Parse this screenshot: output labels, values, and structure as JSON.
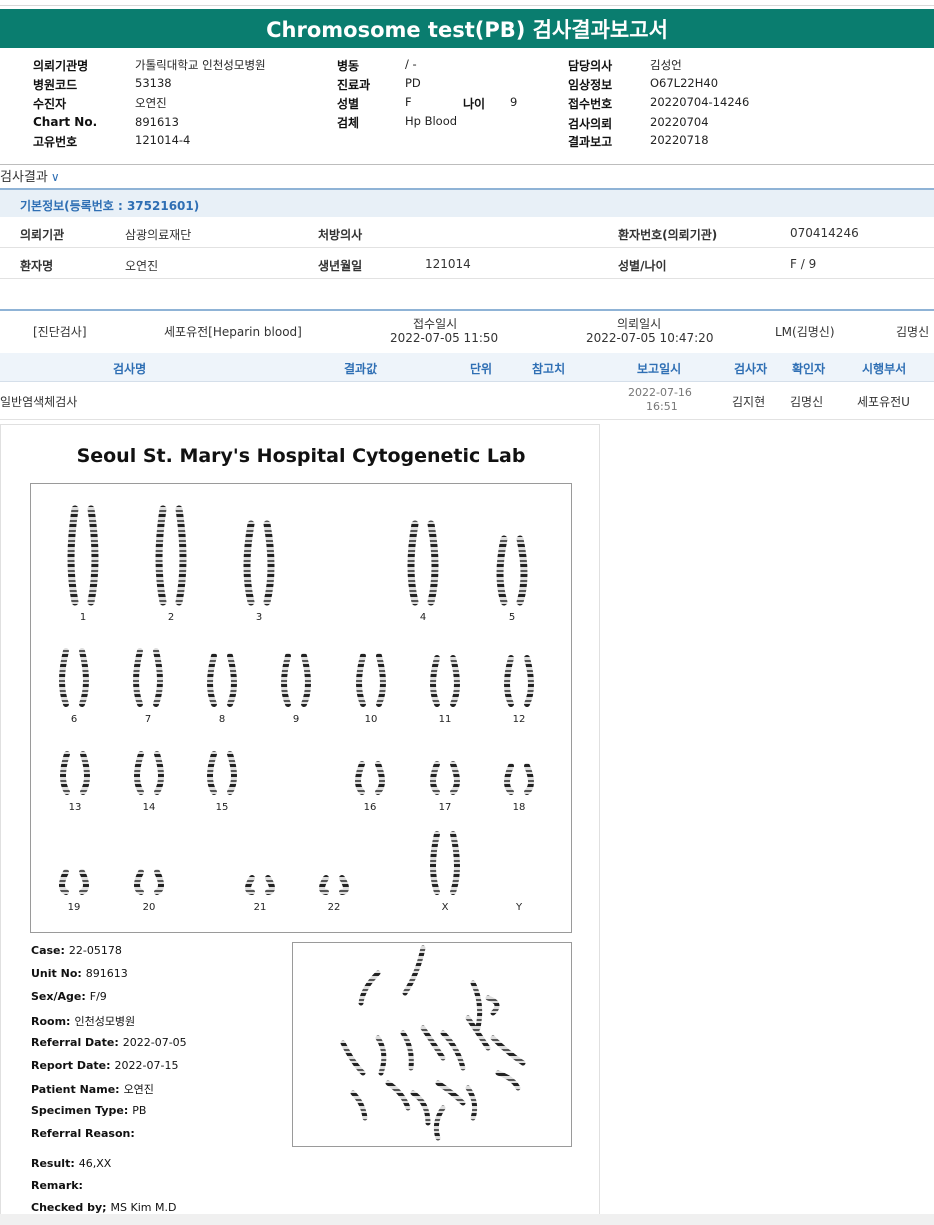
{
  "report_title": "Chromosome test(PB) 검사결과보고서",
  "header": {
    "col1": [
      {
        "label": "의뢰기관명",
        "value": "가톨릭대학교 인천성모병원"
      },
      {
        "label": "병원코드",
        "value": "53138"
      },
      {
        "label": "수진자",
        "value": "오연진"
      },
      {
        "label": "Chart No.",
        "value": "891613"
      },
      {
        "label": "고유번호",
        "value": "121014-4"
      }
    ],
    "col2": [
      {
        "label": "병동",
        "value": "/ -"
      },
      {
        "label": "진료과",
        "value": "PD"
      },
      {
        "label": "성별",
        "value": "F"
      },
      {
        "label": "검체",
        "value": "Hp Blood"
      }
    ],
    "age_label": "나이",
    "age_value": "9",
    "col3": [
      {
        "label": "담당의사",
        "value": "김성언"
      },
      {
        "label": "임상정보",
        "value": "O67L22H40"
      },
      {
        "label": "접수번호",
        "value": "20220704-14246"
      },
      {
        "label": "검사의뢰",
        "value": "20220704"
      },
      {
        "label": "결과보고",
        "value": "20220718"
      }
    ]
  },
  "section_title": "검사결과",
  "basic_info_title": "기본정보(등록번호 : 37521601)",
  "basic": {
    "inst_label": "의뢰기관",
    "inst_value": "삼광의료재단",
    "doctor_label": "처방의사",
    "doctor_value": "",
    "patient_no_label": "환자번호(의뢰기관)",
    "patient_no_value": "070414246",
    "name_label": "환자명",
    "name_value": "오연진",
    "dob_label": "생년월일",
    "dob_value": "121014",
    "sexage_label": "성별/나이",
    "sexage_value": "F / 9"
  },
  "order": {
    "category": "[진단검사]",
    "specimen": "세포유전[Heparin blood]",
    "received_label": "접수일시",
    "received_value": "2022-07-05 11:50",
    "requested_label": "의뢰일시",
    "requested_value": "2022-07-05 10:47:20",
    "lm": "LM(김명신)",
    "staff": "김명신"
  },
  "grid_headers": [
    "검사명",
    "결과값",
    "단위",
    "참고치",
    "보고일시",
    "검사자",
    "확인자",
    "시행부서"
  ],
  "grid_row": {
    "test_name": "일반염색체검사",
    "report_date": "2022-07-16",
    "report_time": "16:51",
    "tester": "김지현",
    "confirmer": "김명신",
    "dept": "세포유전U"
  },
  "lab_title": "Seoul St. Mary's Hospital Cytogenetic Lab",
  "chromosome_labels": [
    "1",
    "2",
    "3",
    "4",
    "5",
    "6",
    "7",
    "8",
    "9",
    "10",
    "11",
    "12",
    "13",
    "14",
    "15",
    "16",
    "17",
    "18",
    "19",
    "20",
    "21",
    "22",
    "X",
    "Y"
  ],
  "lab_fields": [
    {
      "label": "Case:",
      "value": "22-05178"
    },
    {
      "label": "Unit No:",
      "value": "891613"
    },
    {
      "label": "Sex/Age:",
      "value": "F/9"
    },
    {
      "label": "Room:",
      "value": "인천성모병원"
    },
    {
      "label": "Referral Date:",
      "value": "2022-07-05"
    },
    {
      "label": "Report Date:",
      "value": "2022-07-15"
    },
    {
      "label": "Patient Name:",
      "value": "오연진"
    },
    {
      "label": "Specimen Type:",
      "value": "PB"
    },
    {
      "label": "Referral Reason:",
      "value": ""
    }
  ],
  "result_fields": [
    {
      "label": "Result:",
      "value": "46,XX"
    },
    {
      "label": "Remark:",
      "value": ""
    },
    {
      "label": "Checked by;",
      "value": "MS Kim M.D"
    }
  ]
}
